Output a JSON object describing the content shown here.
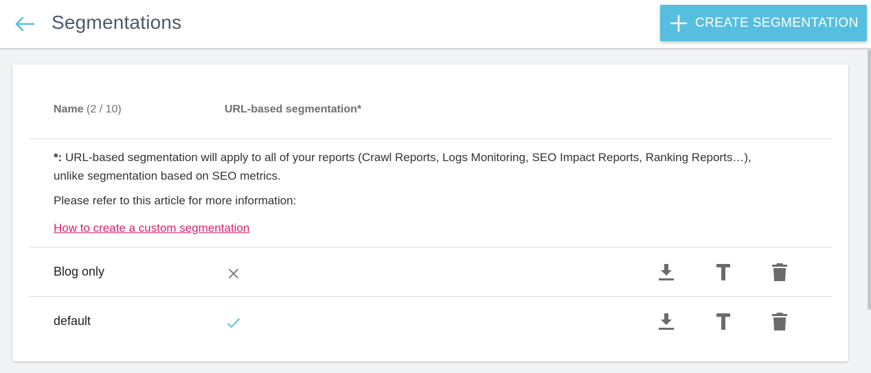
{
  "header": {
    "title": "Segmentations",
    "create_label": "CREATE SEGMENTATION"
  },
  "table": {
    "name_header": "Name",
    "name_count": "(2 / 10)",
    "url_header": "URL-based segmentation*"
  },
  "note": {
    "star": "*:",
    "text": " URL-based segmentation will apply to all of your reports (Crawl Reports, Logs Monitoring, SEO Impact Reports, Ranking Reports…), unlike segmentation based on SEO metrics.",
    "refer": "Please refer to this article for more information:",
    "link_label": "How to create a custom segmentation"
  },
  "rows": [
    {
      "name": "Blog only",
      "url_based": false
    },
    {
      "name": "default",
      "url_based": true
    }
  ],
  "colors": {
    "accent": "#56bfe0",
    "link": "#d61f69",
    "icon": "#6b6b6b"
  },
  "icons": {
    "back": "arrow-left-icon",
    "create": "plus-icon",
    "download": "download-icon",
    "rename": "text-icon",
    "delete": "trash-icon",
    "no": "close-icon",
    "yes": "check-icon"
  }
}
